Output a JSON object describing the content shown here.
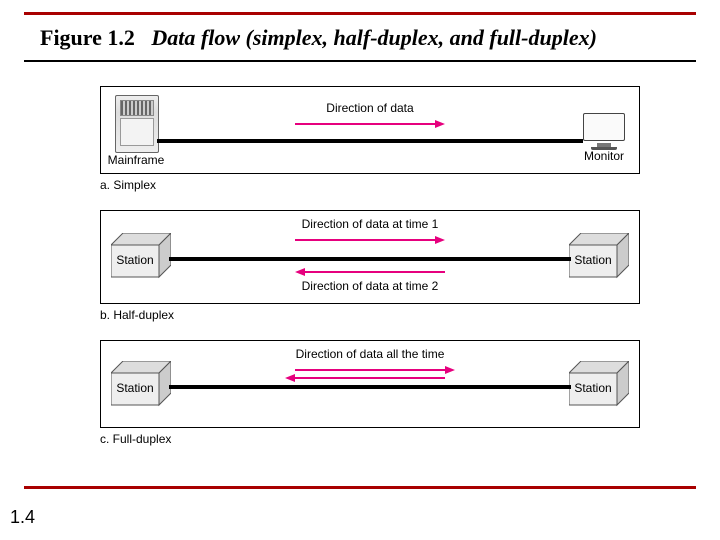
{
  "header": {
    "figure_label": "Figure 1.2",
    "figure_title": "Data flow (simplex, half-duplex, and full-duplex)"
  },
  "panels": {
    "simplex": {
      "caption": "a. Simplex",
      "left_device": "Mainframe",
      "right_device": "Monitor",
      "arrow_label": "Direction of data"
    },
    "half": {
      "caption": "b. Half-duplex",
      "left_device": "Station",
      "right_device": "Station",
      "arrow_top": "Direction of data at time 1",
      "arrow_bottom": "Direction of data at time 2"
    },
    "full": {
      "caption": "c. Full-duplex",
      "left_device": "Station",
      "right_device": "Station",
      "arrow_label": "Direction of data all the time"
    }
  },
  "page_number": "1.4",
  "colors": {
    "rule": "#a80000",
    "arrow": "#e6007e"
  }
}
